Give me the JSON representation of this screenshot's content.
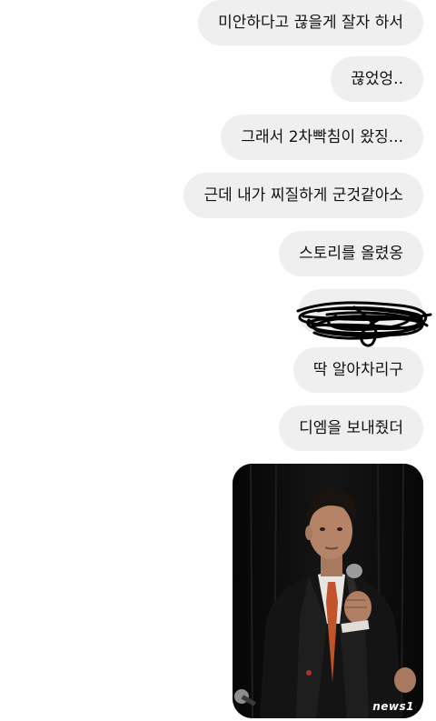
{
  "messages": [
    {
      "text": "미안하다고 끊을게 잘자 하서"
    },
    {
      "text": "끊었엉.."
    },
    {
      "text": "그래서 2차빡침이 왔징..."
    },
    {
      "text": "근데 내가 찌질하게 군것같아소"
    },
    {
      "text": "스토리를 올렸옹"
    },
    {
      "text": ""
    },
    {
      "text": "딱 알아차리구"
    },
    {
      "text": "디엠을 보내줬더"
    }
  ],
  "photo": {
    "icon": "photo-of-man-speaking-with-microphone",
    "watermark": "news1"
  },
  "colors": {
    "bubble": "#efefef",
    "text": "#111111",
    "background": "#ffffff"
  }
}
